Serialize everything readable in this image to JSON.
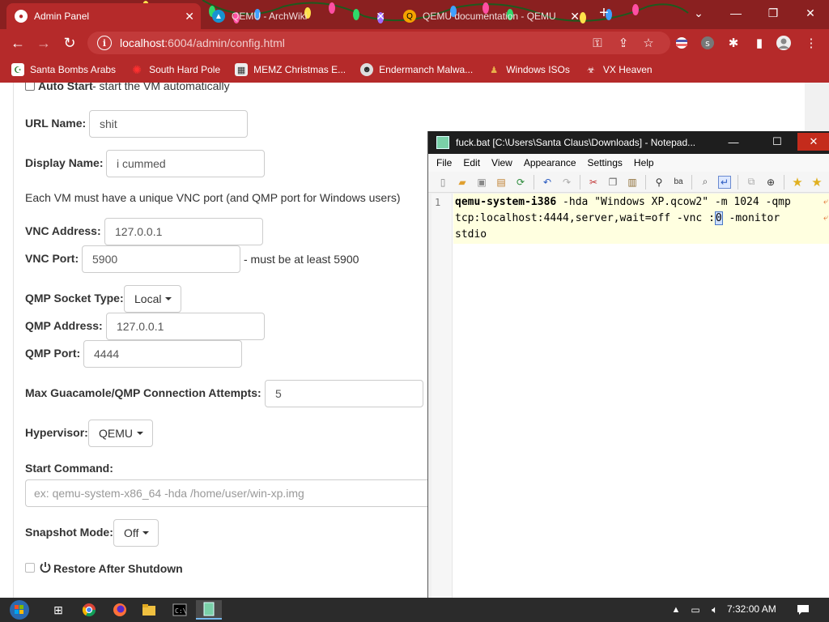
{
  "browser": {
    "tabs": [
      {
        "title": "Admin Panel",
        "active": true
      },
      {
        "title": "QEMU - ArchWiki",
        "active": false
      },
      {
        "title": "QEMU documentation - QEMU",
        "active": false
      }
    ],
    "address": {
      "host": "localhost",
      "path": ":6004/admin/config.html"
    },
    "bookmarks": [
      "Santa Bombs Arabs",
      "South Hard Pole",
      "MEMZ Christmas E...",
      "Endermanch Malwa...",
      "Windows ISOs",
      "VX Heaven"
    ],
    "icons": {
      "back": "arrow-left-icon",
      "forward": "arrow-right-icon",
      "reload": "reload-icon",
      "key": "key-icon",
      "share": "share-icon",
      "star": "star-icon",
      "extensions": "puzzle-icon",
      "sidepanel": "sidepanel-icon",
      "profile": "profile-icon",
      "menu": "kebab-icon"
    }
  },
  "form": {
    "auto_start": {
      "label": "Auto Start",
      "desc": " - start the VM automatically"
    },
    "url_name": {
      "label": "URL Name:",
      "value": "shit"
    },
    "display_name": {
      "label": "Display Name:",
      "value": "i cummed"
    },
    "vnc_note": "Each VM must have a unique VNC port (and QMP port for Windows users)",
    "vnc_address": {
      "label": "VNC Address:",
      "value": "127.0.0.1"
    },
    "vnc_port": {
      "label": "VNC Port:",
      "value": "5900",
      "note": "- must be at least 5900"
    },
    "qmp_socket": {
      "label": "QMP Socket Type:",
      "value": "Local"
    },
    "qmp_address": {
      "label": "QMP Address:",
      "value": "127.0.0.1"
    },
    "qmp_port": {
      "label": "QMP Port:",
      "value": "4444"
    },
    "max_attempts": {
      "label": "Max Guacamole/QMP Connection Attempts:",
      "value": "5"
    },
    "hypervisor": {
      "label": "Hypervisor:",
      "value": "QEMU"
    },
    "start_command": {
      "label": "Start Command:",
      "placeholder": "ex: qemu-system-x86_64 -hda /home/user/win-xp.img"
    },
    "snapshot": {
      "label": "Snapshot Mode:",
      "value": "Off"
    },
    "restore": {
      "label": "Restore After Shutdown"
    }
  },
  "notepad": {
    "title": "fuck.bat [C:\\Users\\Santa Claus\\Downloads] - Notepad...",
    "menu": [
      "File",
      "Edit",
      "View",
      "Appearance",
      "Settings",
      "Help"
    ],
    "line_number": "1",
    "code": {
      "line1_bold": "qemu-system-i386",
      "line1_rest": " -hda \"Windows XP.qcow2\" -m 1024 -qmp",
      "line2_a": "tcp:localhost:4444,server,wait=off -vnc :",
      "line2_cursor": "0",
      "line2_b": " -monitor",
      "line3": "stdio"
    }
  },
  "taskbar": {
    "clock": "7:32:00 AM",
    "apps": [
      "start-orb-icon",
      "task-view-icon",
      "chrome-icon",
      "firefox-icon",
      "explorer-icon",
      "cmd-icon",
      "notepad-icon"
    ]
  }
}
